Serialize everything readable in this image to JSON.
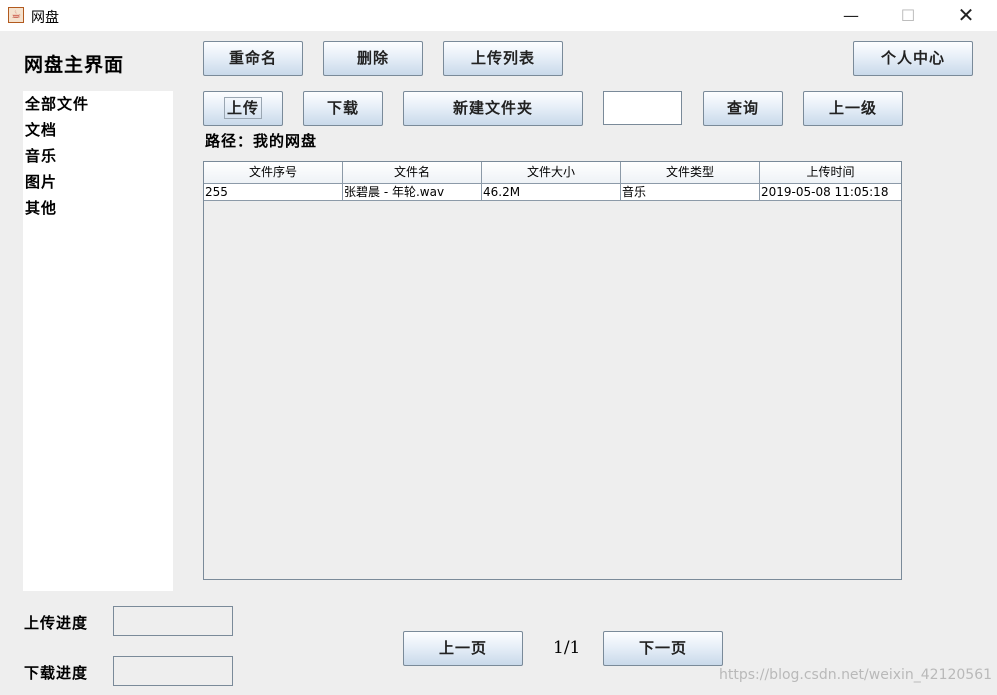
{
  "window": {
    "title": "网盘",
    "min_glyph": "—",
    "max_glyph": "☐",
    "close_glyph": "✕",
    "icon_name": "java-cup-icon"
  },
  "main_title": "网盘主界面",
  "toolbar": {
    "rename": "重命名",
    "delete": "删除",
    "upload_list": "上传列表",
    "profile": "个人中心",
    "upload": "上传",
    "download": "下载",
    "new_folder": "新建文件夹",
    "search_value": "",
    "search": "查询",
    "parent": "上一级"
  },
  "sidebar": {
    "items": [
      {
        "label": "全部文件"
      },
      {
        "label": "文档"
      },
      {
        "label": "音乐"
      },
      {
        "label": "图片"
      },
      {
        "label": "其他"
      }
    ]
  },
  "path": {
    "text": "路径：我的网盘"
  },
  "table": {
    "columns": [
      "文件序号",
      "文件名",
      "文件大小",
      "文件类型",
      "上传时间"
    ],
    "rows": [
      [
        "255",
        "张碧晨 - 年轮.wav",
        "46.2M",
        "音乐",
        "2019-05-08 11:05:18"
      ]
    ]
  },
  "progress": {
    "upload_label": "上传进度",
    "download_label": "下载进度"
  },
  "pager": {
    "prev": "上一页",
    "page": "1/1",
    "next": "下一页"
  },
  "watermark": "https://blog.csdn.net/weixin_42120561"
}
